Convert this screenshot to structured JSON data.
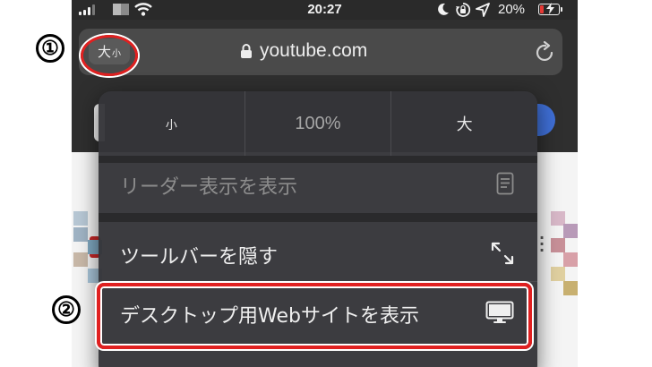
{
  "status_bar": {
    "time": "20:27",
    "battery_percent": "20%",
    "battery_level": 0.2,
    "icons": [
      "signal-icon",
      "wifi-icon",
      "moon-icon",
      "rotation-lock-icon",
      "location-icon",
      "battery-charging-icon"
    ]
  },
  "address_bar": {
    "text_size_label_big": "大",
    "text_size_label_small": "小",
    "url": "youtube.com",
    "icons": [
      "lock-icon",
      "reload-icon"
    ]
  },
  "menu": {
    "zoom_decrease": "小",
    "zoom_level": "100%",
    "zoom_increase": "大",
    "items": [
      {
        "label": "リーダー表示を表示",
        "icon": "reader-icon",
        "enabled": false
      },
      {
        "label": "ツールバーを隠す",
        "icon": "expand-arrows-icon",
        "enabled": true
      },
      {
        "label": "デスクトップ用Webサイトを表示",
        "icon": "desktop-monitor-icon",
        "enabled": true
      }
    ]
  },
  "annotations": {
    "step_1": "①",
    "step_2": "②",
    "highlight_color": "#e02020"
  }
}
